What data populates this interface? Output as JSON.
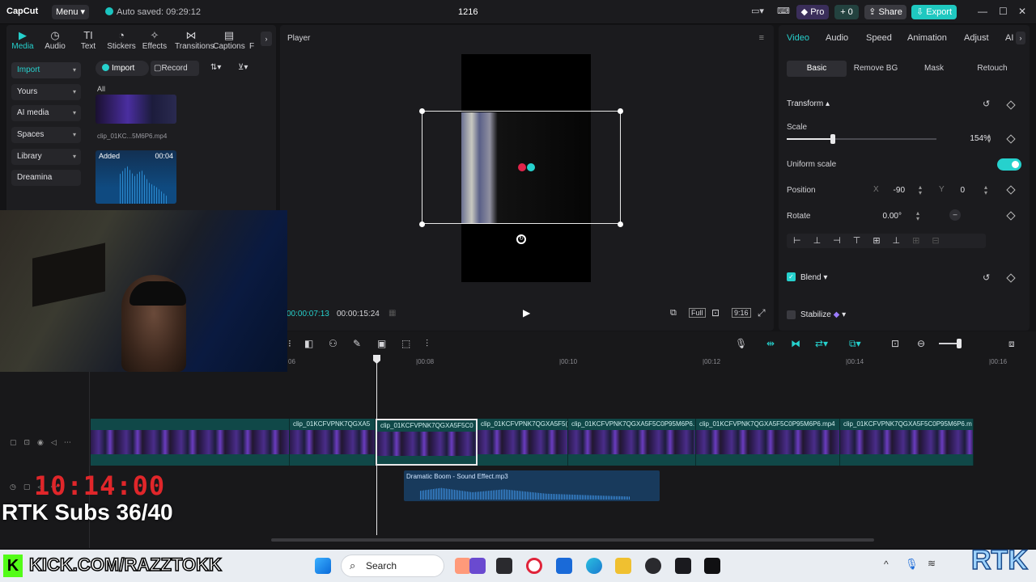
{
  "titlebar": {
    "logo": "CapCut",
    "menu": "Menu",
    "autosave": "Auto saved: 09:29:12",
    "project_name": "1216",
    "pro": "Pro",
    "credits": "0",
    "share": "Share",
    "export": "Export"
  },
  "toolbar": {
    "tabs": [
      {
        "label": "Media",
        "icon": "media-icon"
      },
      {
        "label": "Audio",
        "icon": "audio-icon"
      },
      {
        "label": "Text",
        "icon": "text-icon"
      },
      {
        "label": "Stickers",
        "icon": "stickers-icon"
      },
      {
        "label": "Effects",
        "icon": "effects-icon"
      },
      {
        "label": "Transitions",
        "icon": "transitions-icon"
      },
      {
        "label": "Captions",
        "icon": "captions-icon"
      },
      {
        "label": "F",
        "icon": "filters-icon"
      }
    ]
  },
  "sidebar": {
    "items": [
      {
        "label": "Import"
      },
      {
        "label": "Yours"
      },
      {
        "label": "AI media"
      },
      {
        "label": "Spaces"
      },
      {
        "label": "Library"
      },
      {
        "label": "Dreamina"
      }
    ]
  },
  "media": {
    "import_btn": "Import",
    "record_btn": "Record",
    "filter_all": "All",
    "items": [
      {
        "name": "clip_01KC...5M6P6.mp4"
      },
      {
        "badge": "Added",
        "duration": "00:04"
      }
    ]
  },
  "player": {
    "title": "Player",
    "current_time": "00:00:07:13",
    "total_time": "00:00:15:24",
    "full_label": "Full",
    "ratio_label": "9:16"
  },
  "inspector": {
    "tabs": [
      "Video",
      "Audio",
      "Speed",
      "Animation",
      "Adjust",
      "AI"
    ],
    "subtabs": [
      "Basic",
      "Remove BG",
      "Mask",
      "Retouch"
    ],
    "transform_label": "Transform",
    "scale_label": "Scale",
    "scale_value": "154%",
    "scale_fraction": 0.31,
    "uniform_scale_label": "Uniform scale",
    "position_label": "Position",
    "x_label": "X",
    "x_value": "-90",
    "y_label": "Y",
    "y_value": "0",
    "rotate_label": "Rotate",
    "rotate_value": "0.00°",
    "blend_label": "Blend",
    "stabilize_label": "Stabilize"
  },
  "timeline": {
    "ruler": [
      "06",
      "|00:08",
      "|00:10",
      "|00:12",
      "|00:14",
      "|00:16"
    ],
    "clips": [
      {
        "label": ""
      },
      {
        "label": "clip_01KCFVPNK7QGXA5"
      },
      {
        "label": "clip_01KCFVPNK7QGXA5F5C0"
      },
      {
        "label": "clip_01KCFVPNK7QGXA5F5("
      },
      {
        "label": "clip_01KCFVPNK7QGXA5F5C0P95M6P6."
      },
      {
        "label": "clip_01KCFVPNK7QGXA5F5C0P95M6P6.mp4"
      },
      {
        "label": "clip_01KCFVPNK7QGXA5F5C0P95M6P6.m"
      }
    ],
    "audio_clip": "Dramatic Boom - Sound Effect.mp3"
  },
  "overlay": {
    "timer": "10:14:00",
    "subs": "RTK Subs 36/40",
    "kick": "KICK.COM/RAZZTOKK",
    "rtk_logo": "RTK"
  },
  "taskbar": {
    "search": "Search"
  },
  "colors": {
    "accent": "#26d1cd",
    "clip_teal": "#104848",
    "timer_red": "#e0262a"
  }
}
